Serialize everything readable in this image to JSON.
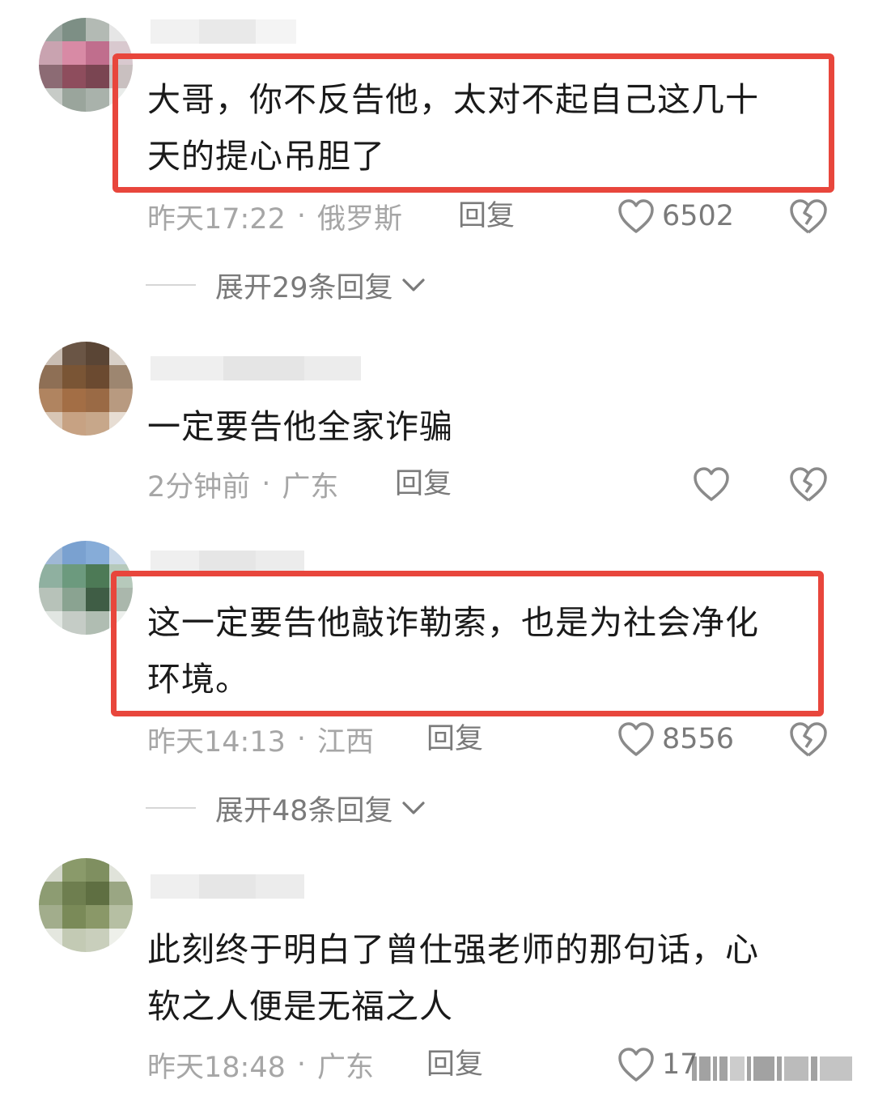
{
  "comments": [
    {
      "text_lines": [
        "大哥，你不反告他，太对不起自己这几十",
        "天的提心吊胆了"
      ],
      "time": "昨天17:22",
      "location": "俄罗斯",
      "reply_label": "回复",
      "likes": "6502",
      "highlighted": true,
      "expand_label": "展开29条回复"
    },
    {
      "text_lines": [
        "一定要告他全家诈骗"
      ],
      "time": "2分钟前",
      "location": "广东",
      "reply_label": "回复",
      "likes": "",
      "highlighted": false
    },
    {
      "text_lines": [
        "这一定要告他敲诈勒索，也是为社会净化",
        "环境。"
      ],
      "time": "昨天14:13",
      "location": "江西",
      "reply_label": "回复",
      "likes": "8556",
      "highlighted": true,
      "expand_label": "展开48条回复"
    },
    {
      "text_lines": [
        "此刻终于明白了曾仕强老师的那句话，心",
        "软之人便是无福之人"
      ],
      "time": "昨天18:48",
      "location": "广东",
      "reply_label": "回复",
      "likes": "17",
      "highlighted": false
    }
  ],
  "separator": "·",
  "icons": {
    "like": "heart-outline-icon",
    "dislike": "broken-heart-icon",
    "expand": "chevron-down-icon"
  },
  "colors": {
    "highlight_border": "#e8463c",
    "meta_text": "#a6a6a6",
    "body_text": "#1a1a1a"
  }
}
